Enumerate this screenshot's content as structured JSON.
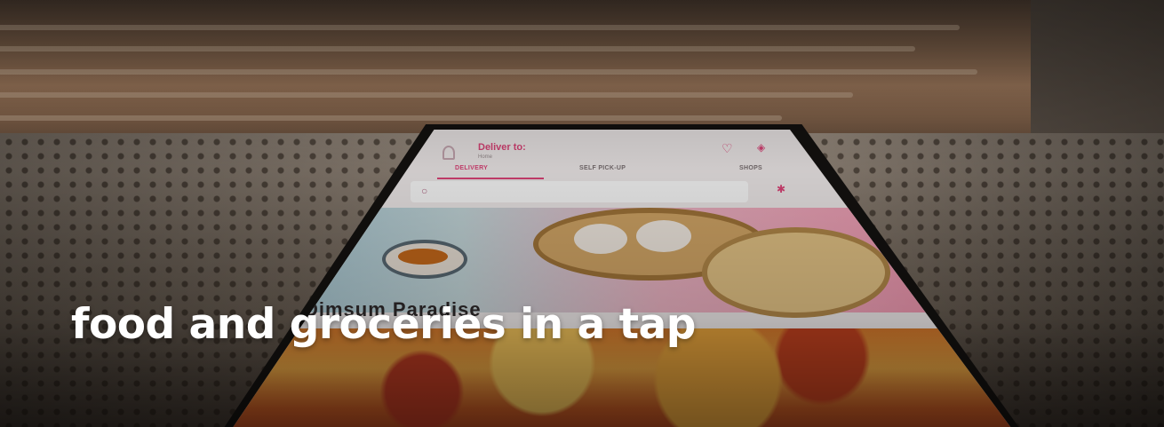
{
  "hero": {
    "headline": "food and groceries in a tap"
  },
  "phone_screen": {
    "deliver_label": "Deliver to:",
    "address": "Home",
    "tabs": [
      {
        "label": "DELIVERY",
        "active": true
      },
      {
        "label": "SELF PICK-UP",
        "active": false
      },
      {
        "label": "SHOPS",
        "active": false
      }
    ],
    "shop_name": "Dimsum Paradise",
    "accent_color": "#e0457a",
    "icons": [
      "user-icon",
      "heart-icon",
      "shopping-bag-icon",
      "search-icon",
      "filter-icon"
    ]
  }
}
